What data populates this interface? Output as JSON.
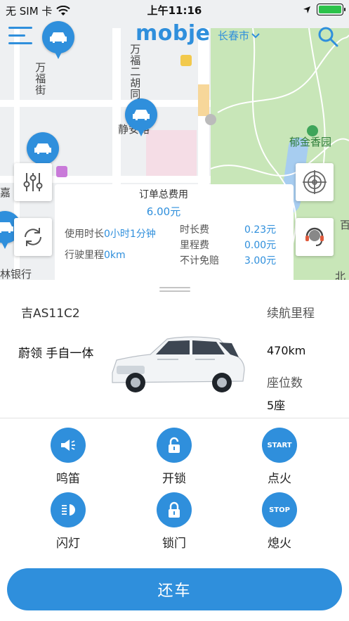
{
  "status_bar": {
    "carrier": "无 SIM 卡",
    "time": "上午11:16"
  },
  "header": {
    "logo": "mobje",
    "city": "长春市"
  },
  "map": {
    "labels": [
      "万福街",
      "万福二胡同",
      "静安路",
      "嘉",
      "林银行",
      "郁金香园",
      "百",
      "北"
    ]
  },
  "fee": {
    "title": "订单总费用",
    "total": "6.00元",
    "duration_label": "使用时长",
    "duration_value": "0小时1分钟",
    "mileage_label": "行驶里程",
    "mileage_value": "0km",
    "time_fee_label": "时长费",
    "time_fee_value": "0.23元",
    "distance_fee_label": "里程费",
    "distance_fee_value": "0.00元",
    "insurance_label": "不计免赔",
    "insurance_value": "3.00元"
  },
  "car": {
    "plate": "吉AS11C2",
    "model": "蔚领 手自一体",
    "range_label": "续航里程",
    "range_value": "470km",
    "seats_label": "座位数",
    "seats_value": "5座"
  },
  "controls": [
    {
      "label": "鸣笛",
      "icon": "horn-icon"
    },
    {
      "label": "开锁",
      "icon": "unlock-icon",
      "text": ""
    },
    {
      "label": "点火",
      "icon": "start-icon",
      "text": "START"
    },
    {
      "label": "闪灯",
      "icon": "headlight-icon"
    },
    {
      "label": "锁门",
      "icon": "lock-icon"
    },
    {
      "label": "熄火",
      "icon": "stop-icon",
      "text": "STOP"
    }
  ],
  "return_button": "还车",
  "colors": {
    "accent": "#2f8fdc",
    "park": "#c8e6b8"
  }
}
